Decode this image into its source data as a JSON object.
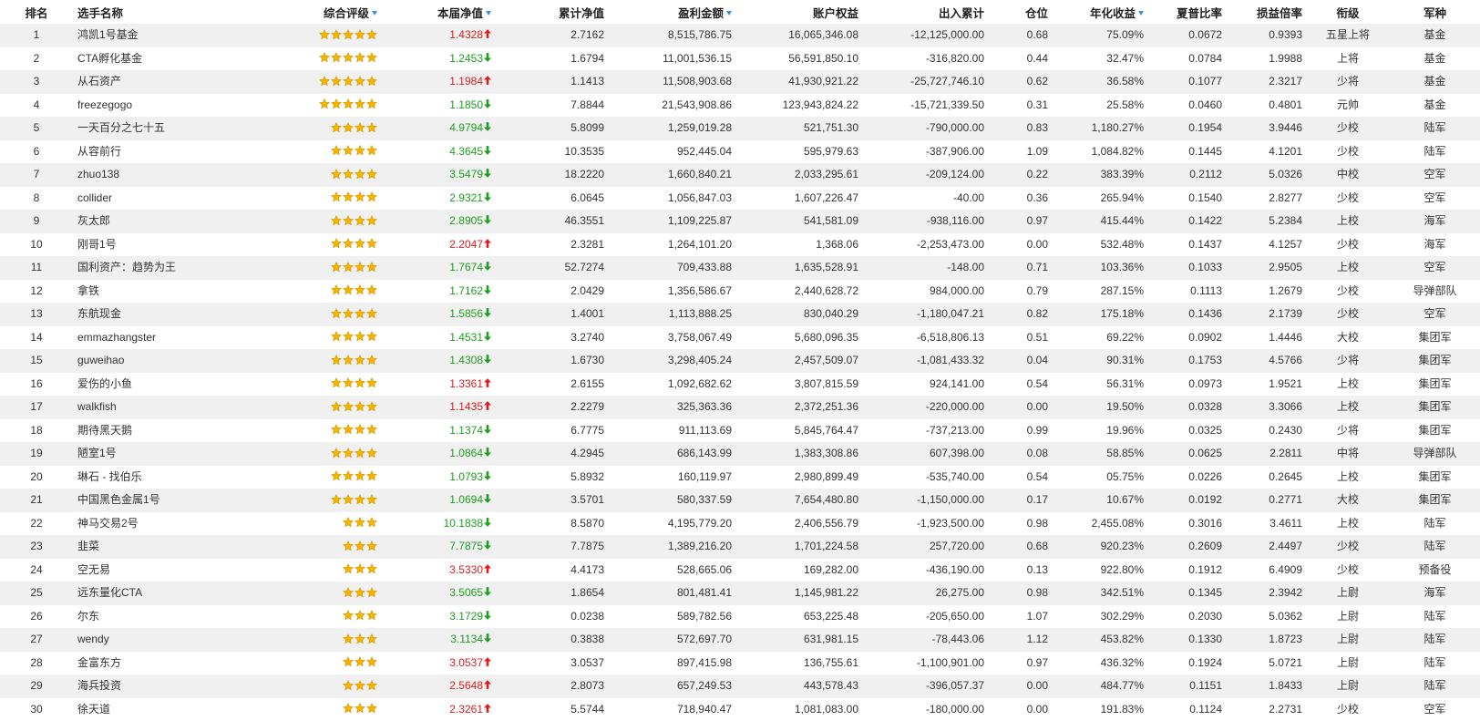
{
  "columns": [
    {
      "label": "排名",
      "sortable": false
    },
    {
      "label": "选手名称",
      "sortable": false
    },
    {
      "label": "综合评级",
      "sortable": true
    },
    {
      "label": "本届净值",
      "sortable": true
    },
    {
      "label": "累计净值",
      "sortable": false
    },
    {
      "label": "盈利金额",
      "sortable": true
    },
    {
      "label": "账户权益",
      "sortable": false
    },
    {
      "label": "出入累计",
      "sortable": false
    },
    {
      "label": "仓位",
      "sortable": false
    },
    {
      "label": "年化收益",
      "sortable": true
    },
    {
      "label": "夏普比率",
      "sortable": false
    },
    {
      "label": "损益倍率",
      "sortable": false
    },
    {
      "label": "衔级",
      "sortable": false
    },
    {
      "label": "军种",
      "sortable": false
    }
  ],
  "colors": {
    "up": "#d81e1e",
    "down": "#1e9e1e",
    "star": "#f5b400",
    "sort_icon": "#3b8fd8",
    "row_alt": "#f0f0f0"
  },
  "rows": [
    {
      "rank": "1",
      "name": "鸿凯1号基金",
      "rating": 5,
      "net_value": "1.4328",
      "trend": "up",
      "cum_net": "2.7162",
      "profit": "8,515,786.75",
      "equity": "16,065,346.08",
      "flow": "-12,125,000.00",
      "position": "0.68",
      "annual": "75.09%",
      "sharpe": "0.0672",
      "pl_ratio": "0.9393",
      "title": "五星上将",
      "branch": "基金"
    },
    {
      "rank": "2",
      "name": "CTA孵化基金",
      "rating": 5,
      "net_value": "1.2453",
      "trend": "down",
      "cum_net": "1.6794",
      "profit": "11,001,536.15",
      "equity": "56,591,850.10",
      "flow": "-316,820.00",
      "position": "0.44",
      "annual": "32.47%",
      "sharpe": "0.0784",
      "pl_ratio": "1.9988",
      "title": "上将",
      "branch": "基金"
    },
    {
      "rank": "3",
      "name": "从石资产",
      "rating": 5,
      "net_value": "1.1984",
      "trend": "up",
      "cum_net": "1.1413",
      "profit": "11,508,903.68",
      "equity": "41,930,921.22",
      "flow": "-25,727,746.10",
      "position": "0.62",
      "annual": "36.58%",
      "sharpe": "0.1077",
      "pl_ratio": "2.3217",
      "title": "少将",
      "branch": "基金"
    },
    {
      "rank": "4",
      "name": "freezegogo",
      "rating": 5,
      "net_value": "1.1850",
      "trend": "down",
      "cum_net": "7.8844",
      "profit": "21,543,908.86",
      "equity": "123,943,824.22",
      "flow": "-15,721,339.50",
      "position": "0.31",
      "annual": "25.58%",
      "sharpe": "0.0460",
      "pl_ratio": "0.4801",
      "title": "元帅",
      "branch": "基金"
    },
    {
      "rank": "5",
      "name": "一天百分之七十五",
      "rating": 4,
      "net_value": "4.9794",
      "trend": "down",
      "cum_net": "5.8099",
      "profit": "1,259,019.28",
      "equity": "521,751.30",
      "flow": "-790,000.00",
      "position": "0.83",
      "annual": "1,180.27%",
      "sharpe": "0.1954",
      "pl_ratio": "3.9446",
      "title": "少校",
      "branch": "陆军"
    },
    {
      "rank": "6",
      "name": "从容前行",
      "rating": 4,
      "net_value": "4.3645",
      "trend": "down",
      "cum_net": "10.3535",
      "profit": "952,445.04",
      "equity": "595,979.63",
      "flow": "-387,906.00",
      "position": "1.09",
      "annual": "1,084.82%",
      "sharpe": "0.1445",
      "pl_ratio": "4.1201",
      "title": "少校",
      "branch": "陆军"
    },
    {
      "rank": "7",
      "name": "zhuo138",
      "rating": 4,
      "net_value": "3.5479",
      "trend": "down",
      "cum_net": "18.2220",
      "profit": "1,660,840.21",
      "equity": "2,033,295.61",
      "flow": "-209,124.00",
      "position": "0.22",
      "annual": "383.39%",
      "sharpe": "0.2112",
      "pl_ratio": "5.0326",
      "title": "中校",
      "branch": "空军"
    },
    {
      "rank": "8",
      "name": "collider",
      "rating": 4,
      "net_value": "2.9321",
      "trend": "down",
      "cum_net": "6.0645",
      "profit": "1,056,847.03",
      "equity": "1,607,226.47",
      "flow": "-40.00",
      "position": "0.36",
      "annual": "265.94%",
      "sharpe": "0.1540",
      "pl_ratio": "2.8277",
      "title": "少校",
      "branch": "空军"
    },
    {
      "rank": "9",
      "name": "灰太郎",
      "rating": 4,
      "net_value": "2.8905",
      "trend": "down",
      "cum_net": "46.3551",
      "profit": "1,109,225.87",
      "equity": "541,581.09",
      "flow": "-938,116.00",
      "position": "0.97",
      "annual": "415.44%",
      "sharpe": "0.1422",
      "pl_ratio": "5.2384",
      "title": "上校",
      "branch": "海军"
    },
    {
      "rank": "10",
      "name": "刚哥1号",
      "rating": 4,
      "net_value": "2.2047",
      "trend": "up",
      "cum_net": "2.3281",
      "profit": "1,264,101.20",
      "equity": "1,368.06",
      "flow": "-2,253,473.00",
      "position": "0.00",
      "annual": "532.48%",
      "sharpe": "0.1437",
      "pl_ratio": "4.1257",
      "title": "少校",
      "branch": "海军"
    },
    {
      "rank": "11",
      "name": "国利资产：趋势为王",
      "rating": 4,
      "net_value": "1.7674",
      "trend": "down",
      "cum_net": "52.7274",
      "profit": "709,433.88",
      "equity": "1,635,528.91",
      "flow": "-148.00",
      "position": "0.71",
      "annual": "103.36%",
      "sharpe": "0.1033",
      "pl_ratio": "2.9505",
      "title": "上校",
      "branch": "空军"
    },
    {
      "rank": "12",
      "name": "拿铁",
      "rating": 4,
      "net_value": "1.7162",
      "trend": "down",
      "cum_net": "2.0429",
      "profit": "1,356,586.67",
      "equity": "2,440,628.72",
      "flow": "984,000.00",
      "position": "0.79",
      "annual": "287.15%",
      "sharpe": "0.1113",
      "pl_ratio": "1.2679",
      "title": "少校",
      "branch": "导弹部队"
    },
    {
      "rank": "13",
      "name": "东航现金",
      "rating": 4,
      "net_value": "1.5856",
      "trend": "down",
      "cum_net": "1.4001",
      "profit": "1,113,888.25",
      "equity": "830,040.29",
      "flow": "-1,180,047.21",
      "position": "0.82",
      "annual": "175.18%",
      "sharpe": "0.1436",
      "pl_ratio": "2.1739",
      "title": "少校",
      "branch": "空军"
    },
    {
      "rank": "14",
      "name": "emmazhangster",
      "rating": 4,
      "net_value": "1.4531",
      "trend": "down",
      "cum_net": "3.2740",
      "profit": "3,758,067.49",
      "equity": "5,680,096.35",
      "flow": "-6,518,806.13",
      "position": "0.51",
      "annual": "69.22%",
      "sharpe": "0.0902",
      "pl_ratio": "1.4446",
      "title": "大校",
      "branch": "集团军"
    },
    {
      "rank": "15",
      "name": "guweihao",
      "rating": 4,
      "net_value": "1.4308",
      "trend": "down",
      "cum_net": "1.6730",
      "profit": "3,298,405.24",
      "equity": "2,457,509.07",
      "flow": "-1,081,433.32",
      "position": "0.04",
      "annual": "90.31%",
      "sharpe": "0.1753",
      "pl_ratio": "4.5766",
      "title": "少将",
      "branch": "集团军"
    },
    {
      "rank": "16",
      "name": "爱伤的小鱼",
      "rating": 4,
      "net_value": "1.3361",
      "trend": "up",
      "cum_net": "2.6155",
      "profit": "1,092,682.62",
      "equity": "3,807,815.59",
      "flow": "924,141.00",
      "position": "0.54",
      "annual": "56.31%",
      "sharpe": "0.0973",
      "pl_ratio": "1.9521",
      "title": "上校",
      "branch": "集团军"
    },
    {
      "rank": "17",
      "name": "walkfish",
      "rating": 4,
      "net_value": "1.1435",
      "trend": "up",
      "cum_net": "2.2279",
      "profit": "325,363.36",
      "equity": "2,372,251.36",
      "flow": "-220,000.00",
      "position": "0.00",
      "annual": "19.50%",
      "sharpe": "0.0328",
      "pl_ratio": "3.3066",
      "title": "上校",
      "branch": "集团军"
    },
    {
      "rank": "18",
      "name": "期待黑天鹅",
      "rating": 4,
      "net_value": "1.1374",
      "trend": "down",
      "cum_net": "6.7775",
      "profit": "911,113.69",
      "equity": "5,845,764.47",
      "flow": "-737,213.00",
      "position": "0.99",
      "annual": "19.96%",
      "sharpe": "0.0325",
      "pl_ratio": "0.2430",
      "title": "少将",
      "branch": "集团军"
    },
    {
      "rank": "19",
      "name": "陋室1号",
      "rating": 4,
      "net_value": "1.0864",
      "trend": "down",
      "cum_net": "4.2945",
      "profit": "686,143.99",
      "equity": "1,383,308.86",
      "flow": "607,398.00",
      "position": "0.08",
      "annual": "58.85%",
      "sharpe": "0.0625",
      "pl_ratio": "2.2811",
      "title": "中将",
      "branch": "导弹部队"
    },
    {
      "rank": "20",
      "name": "琳石 - 找伯乐",
      "rating": 4,
      "net_value": "1.0793",
      "trend": "down",
      "cum_net": "5.8932",
      "profit": "160,119.97",
      "equity": "2,980,899.49",
      "flow": "-535,740.00",
      "position": "0.54",
      "annual": "05.75%",
      "sharpe": "0.0226",
      "pl_ratio": "0.2645",
      "title": "上校",
      "branch": "集团军"
    },
    {
      "rank": "21",
      "name": "中国黑色金属1号",
      "rating": 4,
      "net_value": "1.0694",
      "trend": "down",
      "cum_net": "3.5701",
      "profit": "580,337.59",
      "equity": "7,654,480.80",
      "flow": "-1,150,000.00",
      "position": "0.17",
      "annual": "10.67%",
      "sharpe": "0.0192",
      "pl_ratio": "0.2771",
      "title": "大校",
      "branch": "集团军"
    },
    {
      "rank": "22",
      "name": "神马交易2号",
      "rating": 3,
      "net_value": "10.1838",
      "trend": "down",
      "cum_net": "8.5870",
      "profit": "4,195,779.20",
      "equity": "2,406,556.79",
      "flow": "-1,923,500.00",
      "position": "0.98",
      "annual": "2,455.08%",
      "sharpe": "0.3016",
      "pl_ratio": "3.4611",
      "title": "上校",
      "branch": "陆军"
    },
    {
      "rank": "23",
      "name": "韭菜",
      "rating": 3,
      "net_value": "7.7875",
      "trend": "down",
      "cum_net": "7.7875",
      "profit": "1,389,216.20",
      "equity": "1,701,224.58",
      "flow": "257,720.00",
      "position": "0.68",
      "annual": "920.23%",
      "sharpe": "0.2609",
      "pl_ratio": "2.4497",
      "title": "少校",
      "branch": "陆军"
    },
    {
      "rank": "24",
      "name": "空无易",
      "rating": 3,
      "net_value": "3.5330",
      "trend": "up",
      "cum_net": "4.4173",
      "profit": "528,665.06",
      "equity": "169,282.00",
      "flow": "-436,190.00",
      "position": "0.13",
      "annual": "922.80%",
      "sharpe": "0.1912",
      "pl_ratio": "6.4909",
      "title": "少校",
      "branch": "预备役"
    },
    {
      "rank": "25",
      "name": "远东量化CTA",
      "rating": 3,
      "net_value": "3.5065",
      "trend": "down",
      "cum_net": "1.8654",
      "profit": "801,481.41",
      "equity": "1,145,981.22",
      "flow": "26,275.00",
      "position": "0.98",
      "annual": "342.51%",
      "sharpe": "0.1345",
      "pl_ratio": "2.3942",
      "title": "上尉",
      "branch": "海军"
    },
    {
      "rank": "26",
      "name": "尔东",
      "rating": 3,
      "net_value": "3.1729",
      "trend": "down",
      "cum_net": "0.0238",
      "profit": "589,782.56",
      "equity": "653,225.48",
      "flow": "-205,650.00",
      "position": "1.07",
      "annual": "302.29%",
      "sharpe": "0.2030",
      "pl_ratio": "5.0362",
      "title": "上尉",
      "branch": "陆军"
    },
    {
      "rank": "27",
      "name": "wendy",
      "rating": 3,
      "net_value": "3.1134",
      "trend": "down",
      "cum_net": "0.3838",
      "profit": "572,697.70",
      "equity": "631,981.15",
      "flow": "-78,443.06",
      "position": "1.12",
      "annual": "453.82%",
      "sharpe": "0.1330",
      "pl_ratio": "1.8723",
      "title": "上尉",
      "branch": "陆军"
    },
    {
      "rank": "28",
      "name": "金富东方",
      "rating": 3,
      "net_value": "3.0537",
      "trend": "up",
      "cum_net": "3.0537",
      "profit": "897,415.98",
      "equity": "136,755.61",
      "flow": "-1,100,901.00",
      "position": "0.97",
      "annual": "436.32%",
      "sharpe": "0.1924",
      "pl_ratio": "5.0721",
      "title": "上尉",
      "branch": "陆军"
    },
    {
      "rank": "29",
      "name": "海兵投资",
      "rating": 3,
      "net_value": "2.5648",
      "trend": "up",
      "cum_net": "2.8073",
      "profit": "657,249.53",
      "equity": "443,578.43",
      "flow": "-396,057.37",
      "position": "0.00",
      "annual": "484.77%",
      "sharpe": "0.1151",
      "pl_ratio": "1.8433",
      "title": "上尉",
      "branch": "陆军"
    },
    {
      "rank": "30",
      "name": "徐天道",
      "rating": 3,
      "net_value": "2.3261",
      "trend": "up",
      "cum_net": "5.5744",
      "profit": "718,940.47",
      "equity": "1,081,083.00",
      "flow": "-180,000.00",
      "position": "0.00",
      "annual": "191.83%",
      "sharpe": "0.1124",
      "pl_ratio": "2.2731",
      "title": "少校",
      "branch": "空军"
    }
  ]
}
